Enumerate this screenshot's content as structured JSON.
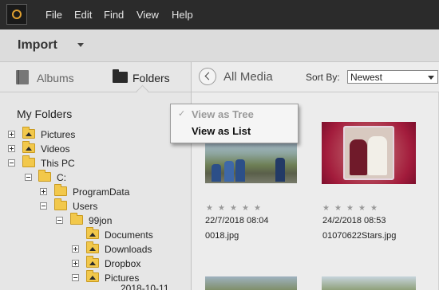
{
  "menubar": {
    "items": [
      "File",
      "Edit",
      "Find",
      "View",
      "Help"
    ]
  },
  "import": {
    "title": "Import"
  },
  "leftpanel": {
    "tabs": {
      "albums": "Albums",
      "folders": "Folders"
    },
    "heading": "My Folders",
    "tree": [
      {
        "label": "Pictures",
        "expander": "plus",
        "icon": "image-folder"
      },
      {
        "label": "Videos",
        "expander": "plus",
        "icon": "image-folder"
      },
      {
        "label": "This PC",
        "expander": "minus",
        "icon": "folder"
      },
      {
        "label": "C:",
        "expander": "minus",
        "icon": "folder"
      },
      {
        "label": "ProgramData",
        "expander": "plus",
        "icon": "folder"
      },
      {
        "label": "Users",
        "expander": "minus",
        "icon": "folder"
      },
      {
        "label": "99jon",
        "expander": "minus",
        "icon": "folder"
      },
      {
        "label": "Documents",
        "expander": "none",
        "icon": "image-folder"
      },
      {
        "label": "Downloads",
        "expander": "plus",
        "icon": "image-folder"
      },
      {
        "label": "Dropbox",
        "expander": "plus",
        "icon": "image-folder"
      },
      {
        "label": "Pictures",
        "expander": "minus",
        "icon": "image-folder"
      },
      {
        "label": "2018-10-11",
        "expander": "none",
        "icon": "folder"
      }
    ]
  },
  "rightpanel": {
    "title": "All Media",
    "sort_label": "Sort By:",
    "sort_value": "Newest",
    "media": [
      {
        "date": "22/7/2018 08:04",
        "filename": "0018.jpg",
        "rating": 0
      },
      {
        "date": "24/2/2018 08:53",
        "filename": "01070622Stars.jpg",
        "rating": 0
      }
    ]
  },
  "popup": {
    "items": [
      "View as Tree",
      "View as List"
    ],
    "checked": "View as Tree"
  },
  "icons": {
    "logo": "app-logo-icon",
    "caret": "dropdown-caret-icon",
    "albums": "albums-icon",
    "folders": "folders-icon",
    "back": "back-arrow-icon",
    "star": "star-icon"
  }
}
